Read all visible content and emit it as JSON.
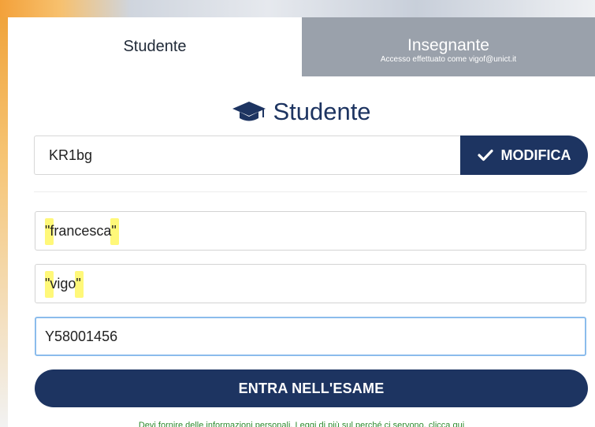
{
  "tabs": {
    "student_label": "Studente",
    "teacher_label": "Insegnante",
    "teacher_subtitle": "Accesso effettuato come vigof@unict.it"
  },
  "heading": {
    "title": "Studente",
    "icon": "graduation-cap-icon"
  },
  "exam_code": {
    "value": "KR1bg",
    "button_label": "MODIFICA",
    "button_icon": "check-icon"
  },
  "form": {
    "first_name_value": "\"francesca\"",
    "last_name_value": "\"vigo\"",
    "student_id_value": "Y58001456"
  },
  "enter_button_label": "ENTRA NELL'ESAME",
  "privacy_note": "Devi fornire delle informazioni personali. Leggi di più sul perché ci servono, clicca qui",
  "colors": {
    "navy": "#1d3461",
    "tab_inactive": "#9aa1ab",
    "focus_border": "#8bbcec",
    "highlight": "#fff76a",
    "privacy_text": "#2e8b2e"
  }
}
